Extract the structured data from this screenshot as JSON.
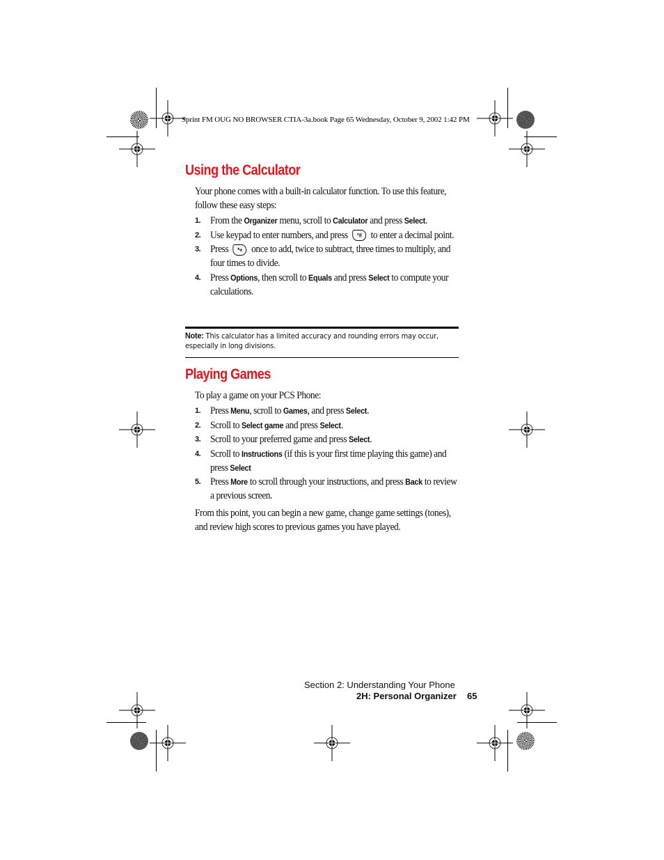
{
  "slug": {
    "text": "Sprint FM OUG NO BROWSER CTIA-3a.book  Page 65  Wednesday, October 9, 2002  1:42 PM"
  },
  "calculator": {
    "heading": "Using the Calculator",
    "intro": "Your phone comes with a built-in calculator function. To use this feature, follow these easy steps:",
    "steps": [
      {
        "num": "1.",
        "parts": [
          {
            "t": "From the "
          },
          {
            "b": "Organizer"
          },
          {
            "t": " menu, scroll to "
          },
          {
            "b": "Calculator"
          },
          {
            "t": " and press "
          },
          {
            "b": "Select"
          },
          {
            "t": "."
          }
        ]
      },
      {
        "num": "2.",
        "parts": [
          {
            "t": "Use keypad to enter numbers, and press "
          },
          {
            "key": "pound-key-icon",
            "glyph": "°#"
          },
          {
            "t": " to enter a decimal point."
          }
        ]
      },
      {
        "num": "3.",
        "parts": [
          {
            "t": "Press "
          },
          {
            "key": "star-key-icon",
            "glyph": "*+"
          },
          {
            "t": " once to add, twice to subtract, three times to multiply, and four times to divide."
          }
        ]
      },
      {
        "num": "4.",
        "parts": [
          {
            "t": "Press "
          },
          {
            "b": "Options"
          },
          {
            "t": ", then scroll to "
          },
          {
            "b": "Equals"
          },
          {
            "t": " and press "
          },
          {
            "b": "Select"
          },
          {
            "t": " to compute your calculations."
          }
        ]
      }
    ],
    "note": {
      "label": "Note:",
      "text": " This calculator has a limited accuracy and rounding errors may occur, especially in long divisions."
    }
  },
  "games": {
    "heading": "Playing Games",
    "intro": "To play a game on your PCS Phone:",
    "steps": [
      {
        "num": "1.",
        "parts": [
          {
            "t": "Press "
          },
          {
            "b": "Menu"
          },
          {
            "t": ", scroll to "
          },
          {
            "b": "Games"
          },
          {
            "t": ", and press "
          },
          {
            "b": "Select"
          },
          {
            "t": "."
          }
        ]
      },
      {
        "num": "2.",
        "parts": [
          {
            "t": "Scroll to "
          },
          {
            "b": "Select game"
          },
          {
            "t": " and press "
          },
          {
            "b": "Select"
          },
          {
            "t": "."
          }
        ]
      },
      {
        "num": "3.",
        "parts": [
          {
            "t": "Scroll to your preferred game and press "
          },
          {
            "b": "Select"
          },
          {
            "t": "."
          }
        ]
      },
      {
        "num": "4.",
        "parts": [
          {
            "t": "Scroll to "
          },
          {
            "b": "Instructions"
          },
          {
            "t": " (if this is your first time playing this game) and press "
          },
          {
            "b": "Select"
          }
        ]
      },
      {
        "num": "5.",
        "parts": [
          {
            "t": "Press "
          },
          {
            "b": "More"
          },
          {
            "t": " to scroll through your instructions, and press "
          },
          {
            "b": "Back"
          },
          {
            "t": " to review a previous screen."
          }
        ]
      }
    ],
    "outro": "From this point, you can begin a new game, change game settings (tones), and review high scores to previous games you have played."
  },
  "footer": {
    "section": "Section 2: Understanding Your Phone",
    "chapter": "2H: Personal Organizer",
    "page": "65"
  }
}
